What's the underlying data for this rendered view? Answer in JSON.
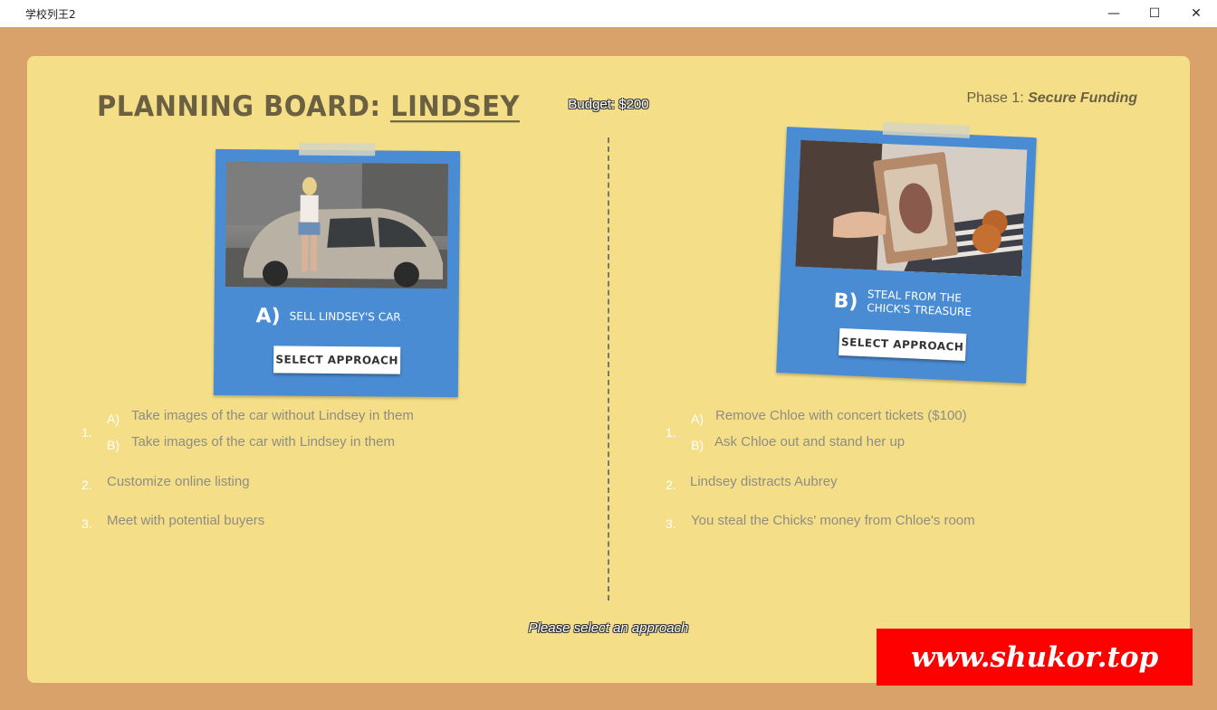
{
  "window": {
    "title": "学校列王2",
    "minimize_icon": "—",
    "maximize_icon": "☐",
    "close_icon": "✕"
  },
  "board": {
    "title_prefix": "PLANNING BOARD: ",
    "title_name": "LINDSEY",
    "budget": "Budget: $200",
    "phase_label": "Phase 1: ",
    "phase_name": "Secure Funding",
    "prompt": "Please select an approach"
  },
  "approaches": [
    {
      "letter": "A)",
      "label": "SELL LINDSEY'S CAR",
      "button": "SELECT APPROACH",
      "steps": [
        {
          "num": "1.",
          "options": [
            {
              "key": "A)",
              "text": "Take images of the car without Lindsey in them"
            },
            {
              "key": "B)",
              "text": "Take images of the car with Lindsey in them"
            }
          ]
        },
        {
          "num": "2.",
          "text": "Customize online listing"
        },
        {
          "num": "3.",
          "text": "Meet with potential buyers"
        }
      ]
    },
    {
      "letter": "B)",
      "label_line1": "STEAL FROM THE",
      "label_line2": "CHICK'S TREASURE",
      "button": "SELECT APPROACH",
      "steps": [
        {
          "num": "1.",
          "options": [
            {
              "key": "A)",
              "text": "Remove Chloe with concert tickets ($100)"
            },
            {
              "key": "B)",
              "text": "Ask Chloe out and stand her up"
            }
          ]
        },
        {
          "num": "2.",
          "text": "Lindsey distracts Aubrey"
        },
        {
          "num": "3.",
          "text": "You steal the Chicks' money from Chloe's room"
        }
      ]
    }
  ],
  "watermark": "www.shukor.top"
}
